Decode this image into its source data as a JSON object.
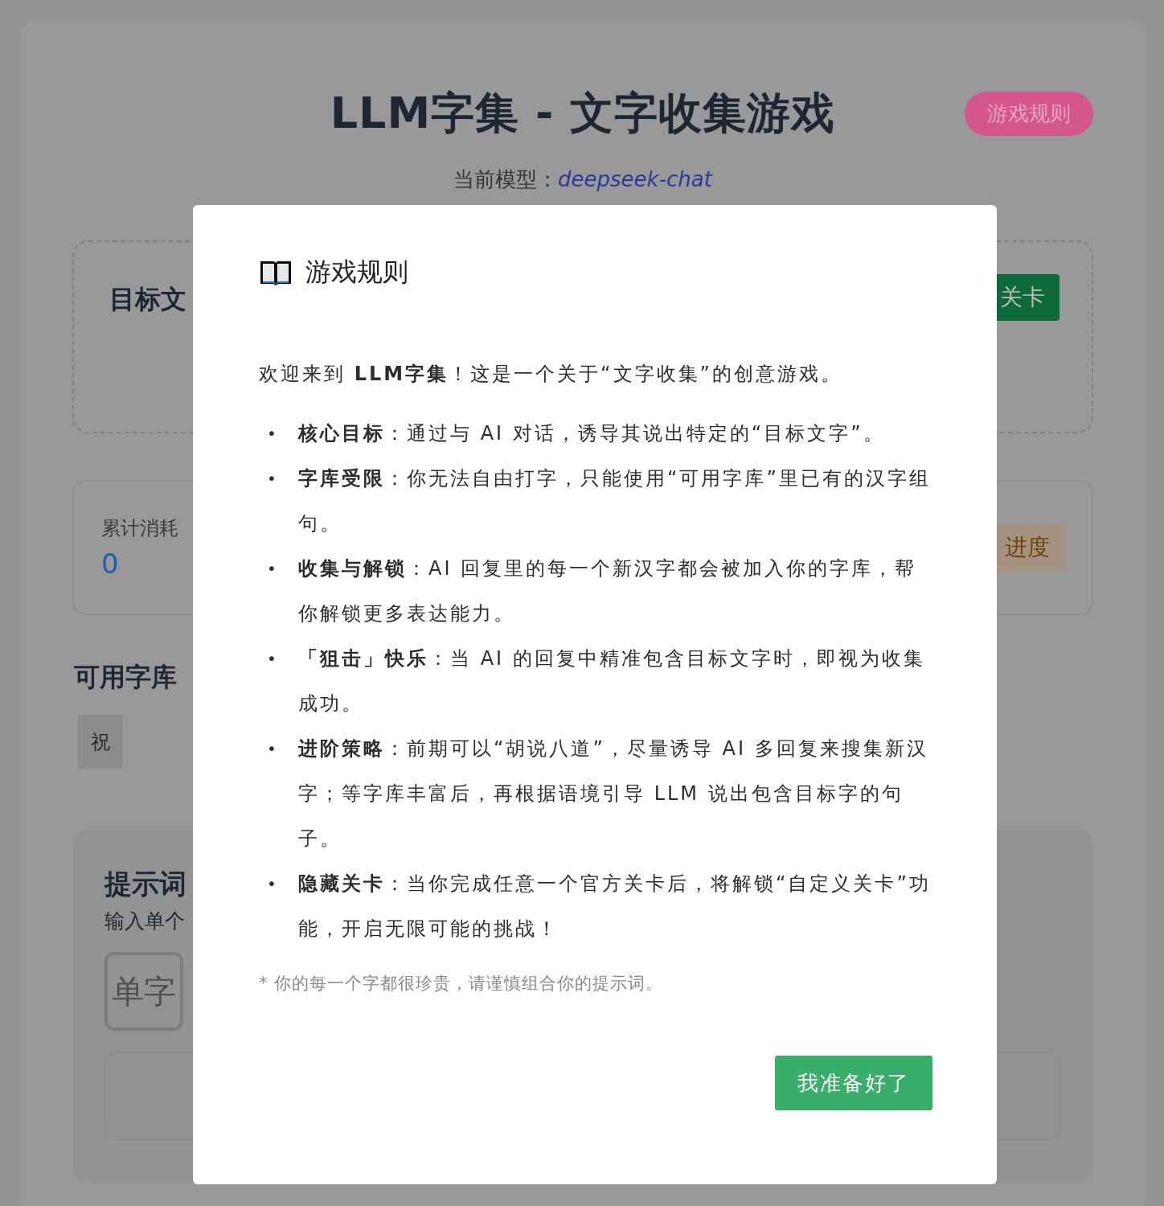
{
  "header": {
    "title": "LLM字集 - 文字收集游戏",
    "rules_button": "游戏规则",
    "model_label": "当前模型：",
    "model_name": "deepseek-chat"
  },
  "target_panel": {
    "heading": "目标文",
    "level_button": "关卡"
  },
  "stats": {
    "label": "累计消耗",
    "value": "0",
    "badge": "进度"
  },
  "library": {
    "heading": "可用字库",
    "chars": [
      "祝"
    ]
  },
  "prompt_panel": {
    "heading": "提示词",
    "hint": "输入单个",
    "char_input": {
      "placeholder": "单字"
    }
  },
  "modal": {
    "title": "游戏规则",
    "intro": "欢迎来到 **LLM字集**！这是一个关于“文字收集”的创意游戏。",
    "rules": [
      {
        "bullet": "•",
        "text": "**核心目标**：通过与 AI 对话，诱导其说出特定的“目标文字”。"
      },
      {
        "bullet": "•",
        "text": "**字库受限**：你无法自由打字，只能使用“可用字库”里已有的汉字组句。"
      },
      {
        "bullet": "•",
        "text": "**收集与解锁**：AI 回复里的每一个新汉字都会被加入你的字库，帮你解锁更多表达能力。"
      },
      {
        "bullet": "•",
        "text": "**「狙击」快乐**：当 AI 的回复中精准包含目标文字时，即视为收集成功。"
      },
      {
        "bullet": "•",
        "text": "**进阶策略**：前期可以“胡说八道”，尽量诱导 AI 多回复来搜集新汉字；等字库丰富后，再根据语境引导 LLM 说出包含目标字的句子。"
      },
      {
        "bullet": "•",
        "text": "**隐藏关卡**：当你完成任意一个官方关卡后，将解锁“自定义关卡”功能，开启无限可能的挑战！"
      }
    ],
    "note": "* 你的每一个字都很珍贵，请谨慎组合你的提示词。",
    "confirm_button": "我准备好了"
  }
}
